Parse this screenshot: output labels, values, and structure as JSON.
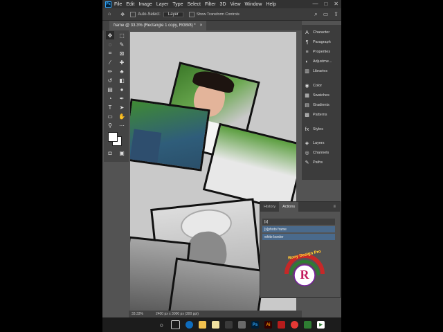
{
  "menubar": {
    "app_icon": "Ps",
    "items": [
      "File",
      "Edit",
      "Image",
      "Layer",
      "Type",
      "Select",
      "Filter",
      "3D",
      "View",
      "Window",
      "Help"
    ],
    "window_controls": [
      "—",
      "□",
      "✕"
    ]
  },
  "options": {
    "auto_select_label": "Auto-Select:",
    "auto_select_value": "Layer",
    "transform_label": "Show Transform Controls"
  },
  "document": {
    "tab_label": "frame @ 33.3% (Rectangle 1 copy, RGB/8) *",
    "close": "×",
    "zoom": "33.33%",
    "dims": "2400 px x 3000 px (300 ppi)"
  },
  "panels": {
    "items": [
      "Character",
      "Paragraph",
      "Properties",
      "Adjustme...",
      "Libraries",
      "Color",
      "Swatches",
      "Gradients",
      "Patterns",
      "Styles",
      "Layers",
      "Channels",
      "Paths"
    ]
  },
  "actions_panel": {
    "tabs": [
      "History",
      "Actions"
    ],
    "rows": [
      "[s]",
      "[s]photo frame",
      "white border"
    ]
  },
  "watermark": {
    "text": "Rony Design Pro",
    "letter": "R"
  },
  "colors": {
    "ps_accent": "#31a8ff",
    "selected_row": "#4a6a8c",
    "canvas_bg": "#c9c9c9"
  }
}
